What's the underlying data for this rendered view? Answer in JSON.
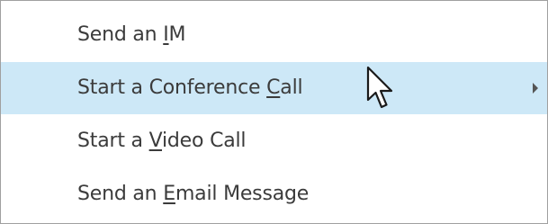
{
  "menu": {
    "items": [
      {
        "before": "Send an ",
        "mnemonic": "I",
        "after": "M",
        "has_submenu": false,
        "highlighted": false
      },
      {
        "before": "Start a Conference ",
        "mnemonic": "C",
        "after": "all",
        "has_submenu": true,
        "highlighted": true
      },
      {
        "before": "Start a ",
        "mnemonic": "V",
        "after": "ideo Call",
        "has_submenu": false,
        "highlighted": false
      },
      {
        "before": "Send an ",
        "mnemonic": "E",
        "after": "mail Message",
        "has_submenu": false,
        "highlighted": false
      }
    ]
  },
  "colors": {
    "highlight": "#cde8f7",
    "text": "#3b3b3b",
    "border": "#a0a0a0"
  },
  "icons": {
    "submenu_arrow": "chevron-right-icon",
    "cursor": "mouse-pointer-icon"
  }
}
